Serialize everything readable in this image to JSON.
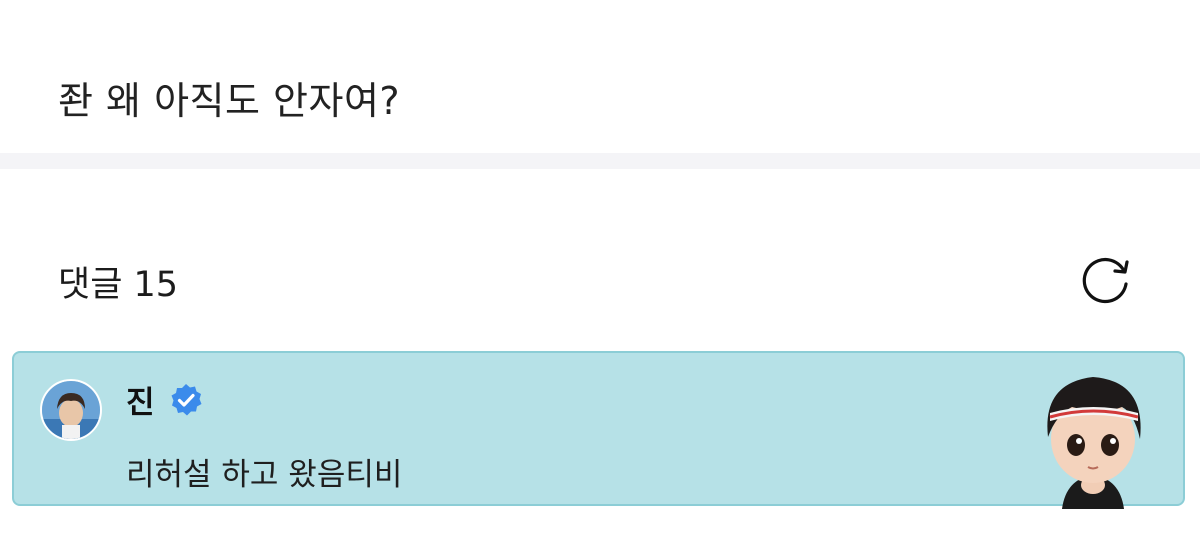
{
  "post": {
    "text": "좐 왜 아직도 안자여?"
  },
  "comments": {
    "header": "댓글 15",
    "refresh_icon": "refresh-icon"
  },
  "highlighted_comment": {
    "author": "진",
    "verified_icon": "verified-badge-icon",
    "text": "리허설 하고 왔음티비",
    "background_color": "#b6e1e7",
    "border_color": "#8ccdd6"
  },
  "colors": {
    "verified_badge": "#3b8beb",
    "divider": "#f4f4f7"
  }
}
